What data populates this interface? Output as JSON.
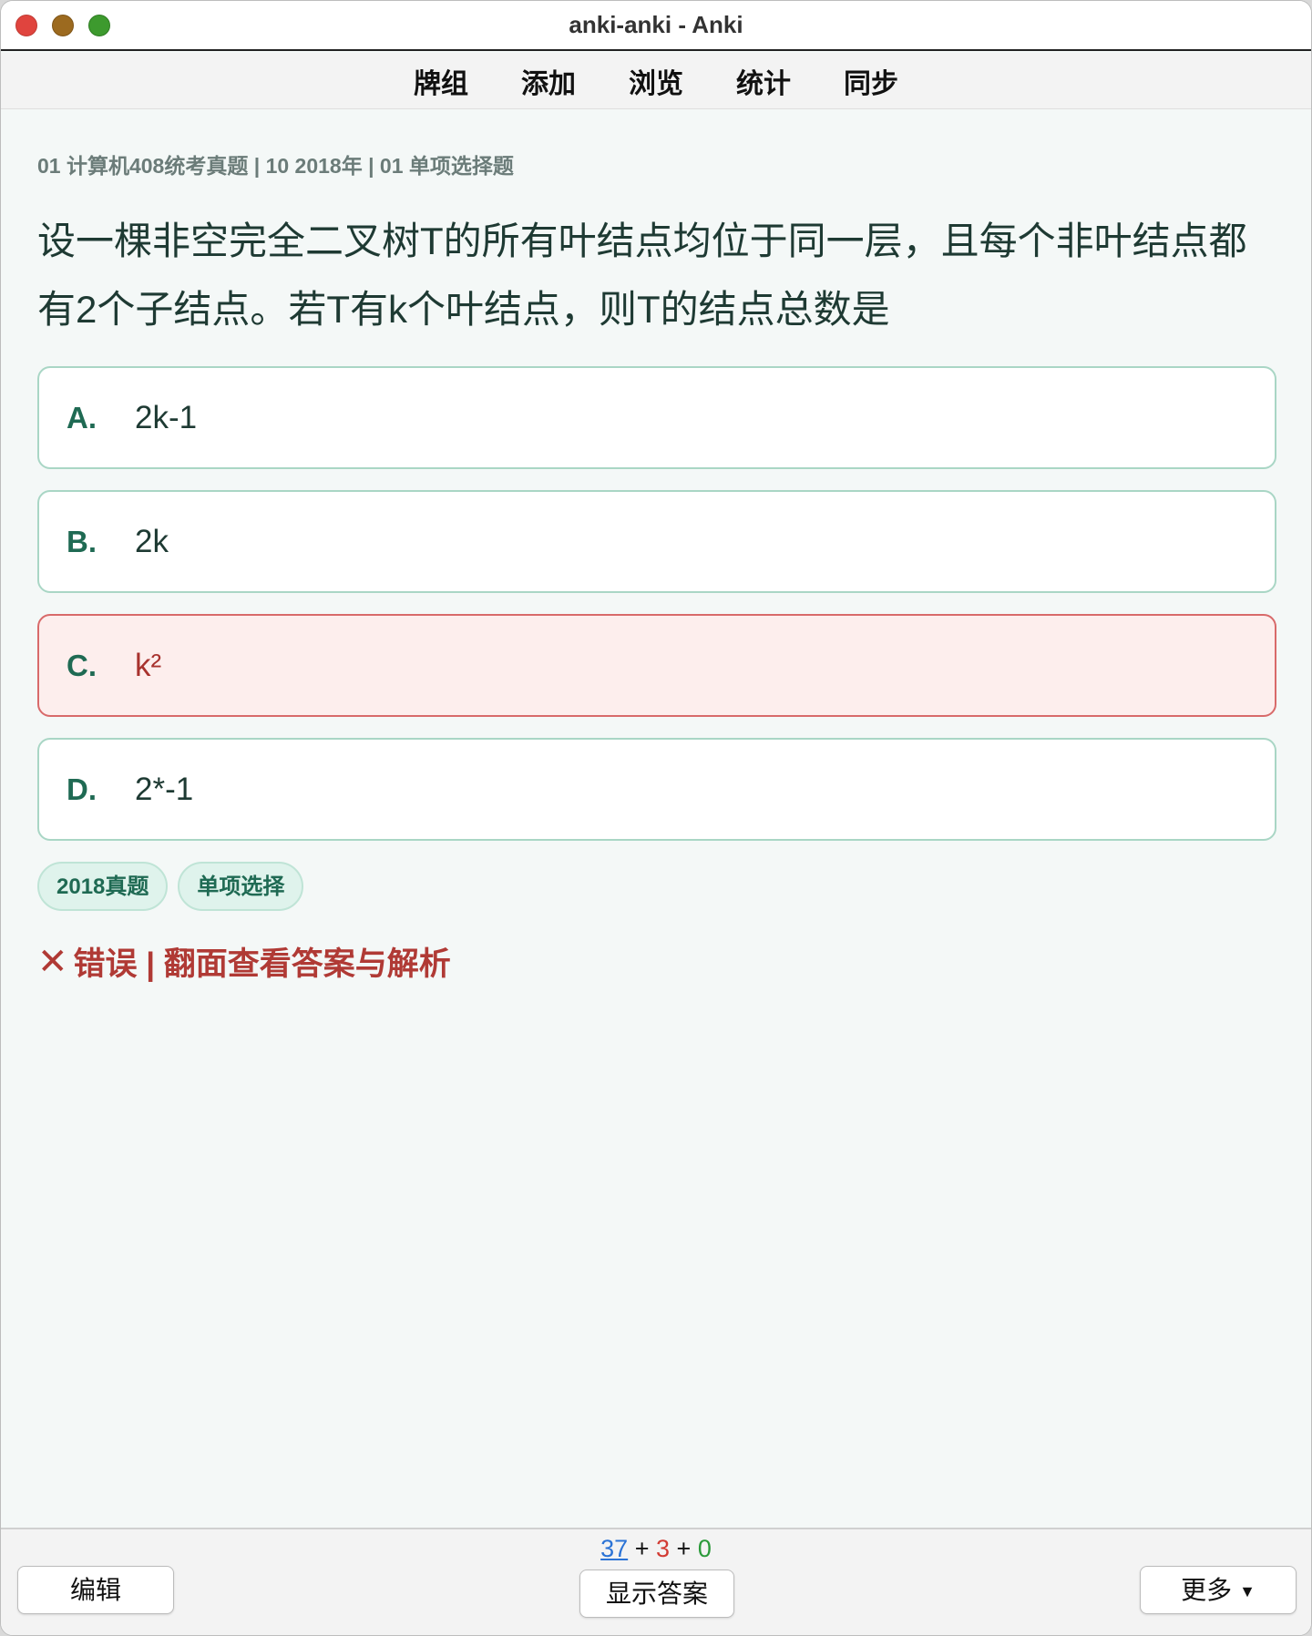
{
  "window": {
    "title": "anki-anki - Anki"
  },
  "toolbar": {
    "items": [
      "牌组",
      "添加",
      "浏览",
      "统计",
      "同步"
    ]
  },
  "card": {
    "breadcrumb": "01 计算机408统考真题 | 10 2018年 | 01 单项选择题",
    "question": "设一棵非空完全二叉树T的所有叶结点均位于同一层，且每个非叶结点都有2个子结点。若T有k个叶结点，则T的结点总数是",
    "options": [
      {
        "letter": "A.",
        "text": "2k-1",
        "state": "normal"
      },
      {
        "letter": "B.",
        "text": "2k",
        "state": "normal"
      },
      {
        "letter": "C.",
        "text": "k²",
        "state": "wrong"
      },
      {
        "letter": "D.",
        "text": "2*-1",
        "state": "normal"
      }
    ],
    "tags": [
      "2018真题",
      "单项选择"
    ],
    "result": {
      "icon": "✕",
      "text": "错误 | 翻面查看答案与解析"
    }
  },
  "bottom": {
    "edit_label": "编辑",
    "show_answer_label": "显示答案",
    "more_label": "更多",
    "counts": {
      "new": "37",
      "plus1": "+",
      "learn": "3",
      "plus2": "+",
      "review": "0"
    }
  },
  "colors": {
    "accent": "#1f6a53",
    "wrong": "#b03a35",
    "background": "#f4f8f7"
  }
}
